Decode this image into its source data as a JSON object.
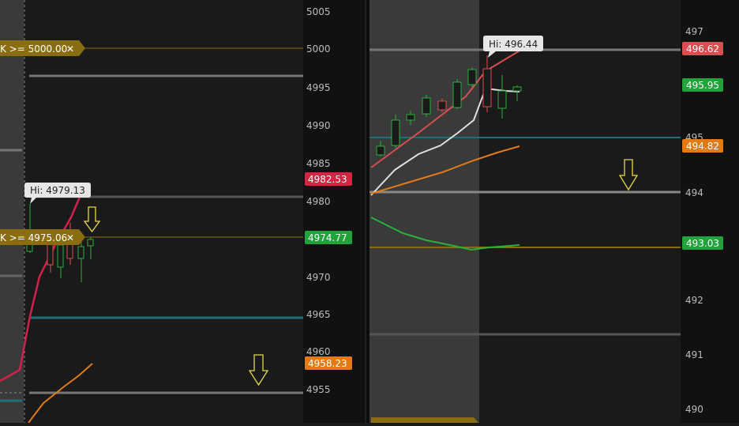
{
  "left_panel": {
    "y_ticks": [
      "5005",
      "5000",
      "4995",
      "4990",
      "4985",
      "4980",
      "4975",
      "4970",
      "4965",
      "4960",
      "4955"
    ],
    "alert_labels": [
      {
        "text": "K >= 5000.00",
        "close": "✕"
      },
      {
        "text": "K >= 4975.06",
        "close": "✕"
      }
    ],
    "hi_tooltip": "Hi: 4979.13",
    "price_badges": [
      {
        "value": "4982.53",
        "color": "#d62445"
      },
      {
        "value": "4974.77",
        "color": "#1fa33a"
      },
      {
        "value": "4958.23",
        "color": "#e37a14"
      }
    ],
    "arrow_icons": [
      "down-arrow-icon",
      "down-arrow-icon"
    ]
  },
  "right_panel": {
    "y_ticks": [
      "497",
      "495",
      "494",
      "492",
      "491",
      "490"
    ],
    "hi_tooltip": "Hi: 496.44",
    "price_badges": [
      {
        "value": "496.62",
        "color": "#d94e4e"
      },
      {
        "value": "495.95",
        "color": "#1fa33a"
      },
      {
        "value": "494.82",
        "color": "#e37a14"
      },
      {
        "value": "493.03",
        "color": "#1fa33a"
      }
    ],
    "arrow_icons": [
      "down-arrow-icon"
    ]
  },
  "colors": {
    "background": "#1a1a1a",
    "shaded_session": "#3a3a3a",
    "alert_gold": "#8a6d10",
    "teal_line": "#1e6f78",
    "red_ma": "#d0224a",
    "orange_ma": "#e07a1a",
    "white_ma": "#e0e0e0",
    "green_ma": "#2bb03a",
    "axis_bg": "#111111"
  }
}
